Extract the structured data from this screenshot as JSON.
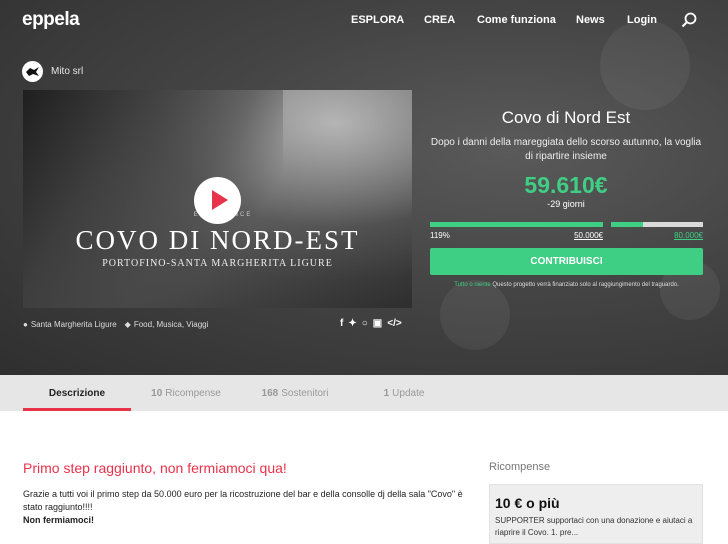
{
  "nav": {
    "logo": "eppela",
    "items": [
      "ESPLORA",
      "CREA",
      "Come funziona",
      "News",
      "Login"
    ]
  },
  "owner": {
    "name": "Mito srl"
  },
  "video": {
    "experience_label": "EXPERIENCE",
    "title": "COVO DI NORD-EST",
    "subtitle": "PORTOFINO-SANTA MARGHERITA LIGURE"
  },
  "meta": {
    "location": "Santa Margherita Ligure",
    "tags": "Food, Musica, Viaggi"
  },
  "share": {
    "icons": [
      "facebook-icon",
      "twitter-icon",
      "whatsapp-icon",
      "flipboard-icon",
      "embed-icon"
    ]
  },
  "project": {
    "title": "Covo di Nord Est",
    "description": "Dopo i danni della mareggiata dello scorso autunno, la voglia di ripartire insieme",
    "amount": "59.610€",
    "days": "-29 giorni",
    "percent_label": "119%",
    "progress_step1": 1.0,
    "progress_step2": 0.35,
    "goal1": "50.000€",
    "goal2": "80.000€",
    "cta": "CONTRIBUISCI",
    "note_highlight": "Tutto o niente",
    "note_text": "Questo progetto verrà finanziato solo al raggiungimento del traguardo."
  },
  "tabs": [
    {
      "count": "",
      "label": "Descrizione"
    },
    {
      "count": "10",
      "label": "Ricompense"
    },
    {
      "count": "168",
      "label": "Sostenitori"
    },
    {
      "count": "1",
      "label": "Update"
    }
  ],
  "description": {
    "title": "Primo step raggiunto, non fermiamoci qua!",
    "text": "Grazie a tutti voi il primo step da 50.000 euro per la ricostruzione del bar e della consolle dj della sala \"Covo\" è stato raggiunto!!!!",
    "bold": "Non fermiamoci!"
  },
  "rewards": {
    "title": "Ricompense",
    "first": {
      "amount": "10 € o più",
      "text": "SUPPORTER supportaci con una donazione e aiutaci a riaprire il Covo. 1. pre..."
    }
  },
  "colors": {
    "accent_green": "#3fcf84",
    "accent_red": "#e8334a"
  }
}
